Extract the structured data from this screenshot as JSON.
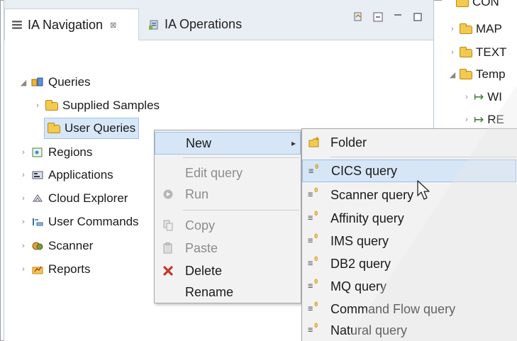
{
  "tabs": [
    {
      "label": "IA Navigation",
      "icon": "navigation-list-icon",
      "active": true,
      "close_glyph": "⊠"
    },
    {
      "label": "IA Operations",
      "icon": "operations-icon",
      "active": false
    }
  ],
  "tree": {
    "root": {
      "label": "Queries",
      "icon": "queries-icon",
      "expanded_glyph": "◢"
    },
    "children": [
      {
        "label": "Supplied Samples",
        "icon": "folder-icon"
      },
      {
        "label": "User Queries",
        "icon": "folder-icon",
        "selected": true
      }
    ],
    "items": [
      {
        "label": "Regions",
        "icon": "regions-icon"
      },
      {
        "label": "Applications",
        "icon": "applications-icon"
      },
      {
        "label": "Cloud Explorer",
        "icon": "cloud-explorer-icon"
      },
      {
        "label": "User Commands",
        "icon": "user-commands-icon"
      },
      {
        "label": "Scanner",
        "icon": "scanner-icon"
      },
      {
        "label": "Reports",
        "icon": "reports-icon"
      }
    ]
  },
  "right_panel": {
    "items": [
      "CON",
      "MAP",
      "TEXT",
      "Temp",
      "WI",
      "RE"
    ]
  },
  "context_menu": {
    "items": [
      {
        "label": "New",
        "has_submenu": true,
        "highlight": true
      },
      {
        "label": "Edit query",
        "disabled": true
      },
      {
        "label": "Run",
        "disabled": true,
        "icon": "run-icon"
      },
      {
        "label": "Copy",
        "disabled": true,
        "icon": "copy-icon"
      },
      {
        "label": "Paste",
        "disabled": true,
        "icon": "paste-icon"
      },
      {
        "label": "Delete",
        "icon": "delete-icon"
      },
      {
        "label": "Rename"
      }
    ],
    "submenu_arrow": "▸"
  },
  "submenu": {
    "items": [
      {
        "label": "Folder",
        "icon": "new-folder-icon"
      },
      {
        "label": "CICS query",
        "icon": "query-icon",
        "highlight": true
      },
      {
        "label": "Scanner query",
        "icon": "query-icon"
      },
      {
        "label": "Affinity query",
        "icon": "query-icon"
      },
      {
        "label": "IMS query",
        "icon": "query-icon"
      },
      {
        "label": "DB2 query",
        "icon": "query-icon"
      },
      {
        "label": "MQ query",
        "icon": "query-icon"
      },
      {
        "label": "Command Flow query",
        "icon": "query-icon"
      },
      {
        "label": "Natural query",
        "icon": "query-icon"
      }
    ]
  },
  "colors": {
    "selection": "#d7e7f7",
    "menu_background": "#f2f2f2",
    "delete_red": "#c0392b",
    "folder_yellow": "#f3c94f"
  }
}
